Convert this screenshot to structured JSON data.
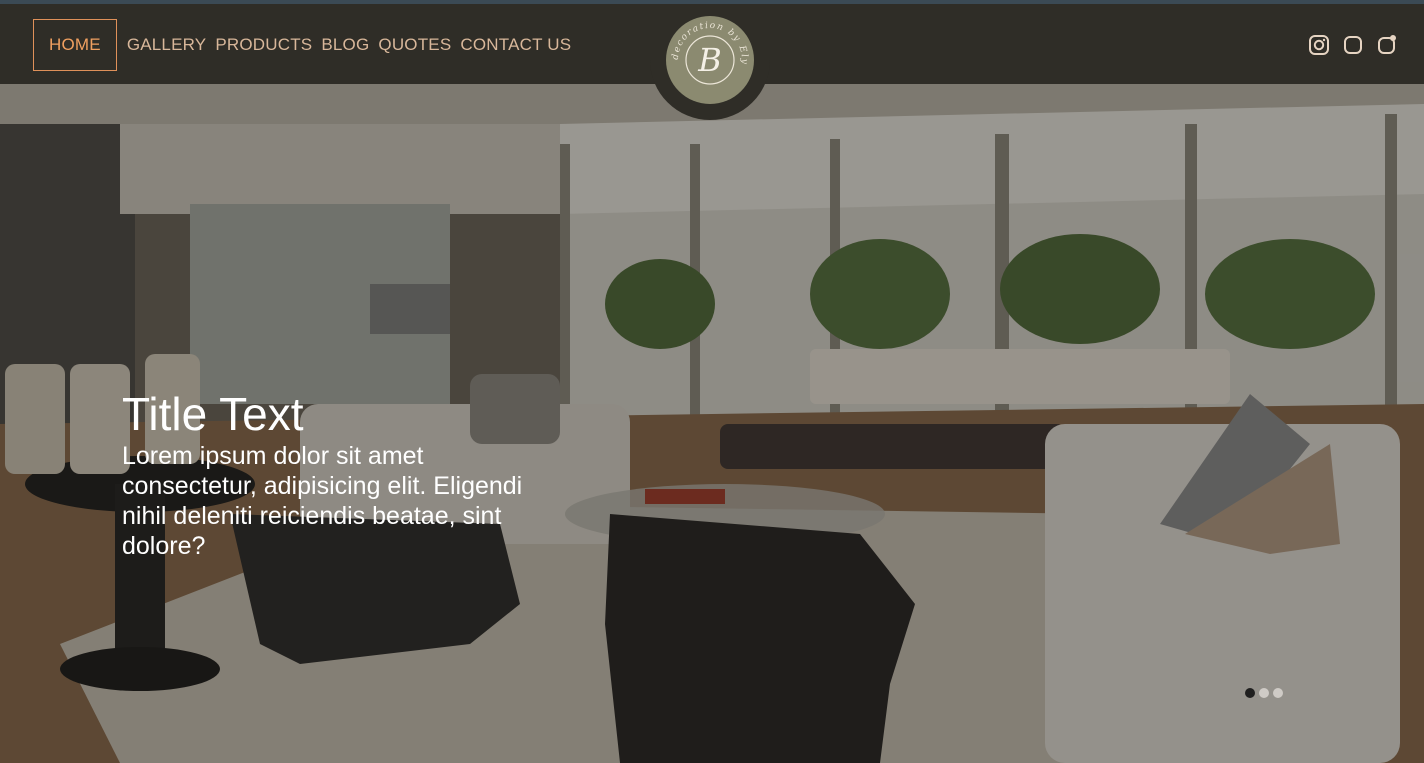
{
  "nav": {
    "links": [
      {
        "label": "HOME",
        "active": true
      },
      {
        "label": "GALLERY",
        "active": false
      },
      {
        "label": "PRODUCTS",
        "active": false
      },
      {
        "label": "BLOG",
        "active": false
      },
      {
        "label": "QUOTES",
        "active": false
      },
      {
        "label": "CONTACT US",
        "active": false
      }
    ]
  },
  "logo": {
    "letter": "B",
    "ring_text": "decoration by Ely"
  },
  "social": {
    "icons": [
      "instagram-icon",
      "rounded-square-icon",
      "notification-square-icon"
    ]
  },
  "hero": {
    "title": "Title Text",
    "body": "Lorem ipsum dolor sit amet consectetur, adipisicing elit. Eligendi nihil deleniti reiciendis beatae, sint dolore?",
    "slides": 3,
    "active_slide": 1
  },
  "colors": {
    "nav_bg": "#2f2d27",
    "nav_text": "#d8b79a",
    "accent": "#f0a060",
    "logo_bg": "#8b8a70"
  }
}
